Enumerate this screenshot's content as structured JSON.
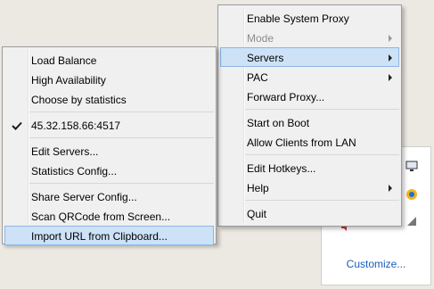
{
  "main_menu": {
    "items": [
      {
        "label": "Enable System Proxy"
      },
      {
        "label": "Mode"
      },
      {
        "label": "Servers"
      },
      {
        "label": "PAC"
      },
      {
        "label": "Forward Proxy..."
      },
      {
        "label": "Start on Boot"
      },
      {
        "label": "Allow Clients from LAN"
      },
      {
        "label": "Edit Hotkeys..."
      },
      {
        "label": "Help"
      },
      {
        "label": "Quit"
      }
    ]
  },
  "servers_menu": {
    "items": [
      {
        "label": "Load Balance"
      },
      {
        "label": "High Availability"
      },
      {
        "label": "Choose by statistics"
      },
      {
        "label": "45.32.158.66:4517",
        "checked": true
      },
      {
        "label": "Edit Servers..."
      },
      {
        "label": "Statistics Config..."
      },
      {
        "label": "Share Server Config..."
      },
      {
        "label": "Scan QRCode from Screen..."
      },
      {
        "label": "Import URL from Clipboard..."
      }
    ]
  },
  "tray_panel": {
    "customize_label": "Customize...",
    "icons": [
      "monitor-icon",
      "colorful-tray-icon",
      "network-icon",
      "volume-icon"
    ]
  },
  "colors": {
    "highlight": "#cde2f7",
    "highlight_border": "#8fb6e3",
    "link": "#1c5dbd",
    "disabled_text": "#8d8d8d"
  }
}
